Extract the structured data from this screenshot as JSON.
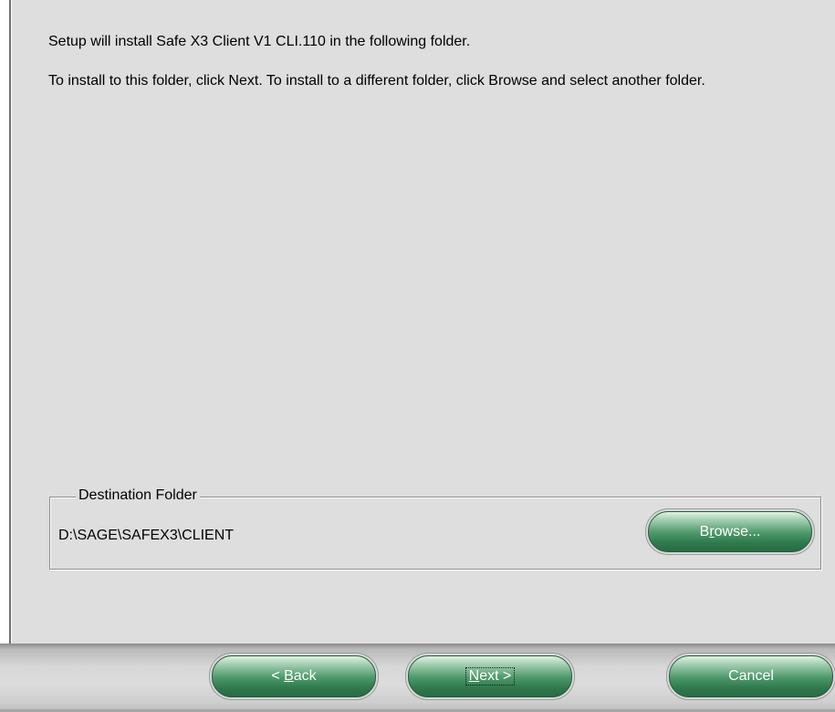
{
  "dialog": {
    "message_line1": "Setup will install Safe X3 Client V1 CLI.110 in the following folder.",
    "message_line2": "To install to this folder, click Next. To install to a different folder, click Browse and select another folder."
  },
  "destination": {
    "group_label": "Destination Folder",
    "path": "D:\\SAGE\\SAFEX3\\CLIENT",
    "browse_label_pre": "B",
    "browse_label_hot": "r",
    "browse_label_post": "owse..."
  },
  "footer": {
    "back_label_pre": "< ",
    "back_label_hot": "B",
    "back_label_post": "ack",
    "next_label_hot": "N",
    "next_label_post": "ext >",
    "cancel_label": "Cancel"
  },
  "colors": {
    "panel_bg": "#dedede",
    "button_green": "#2f7a4d",
    "button_text": "#ffffff"
  }
}
